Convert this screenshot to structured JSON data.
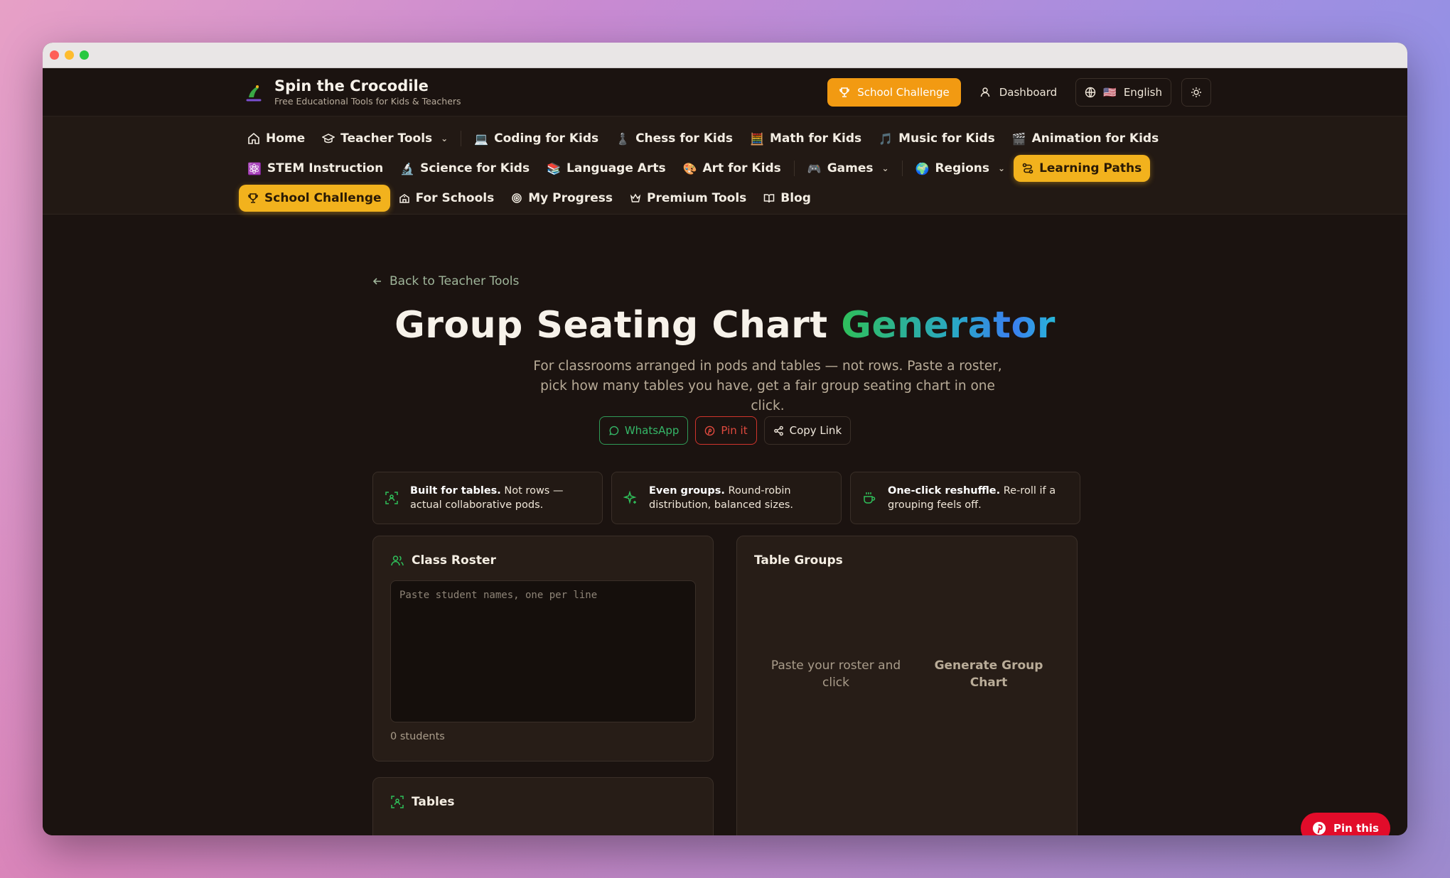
{
  "header": {
    "brand_title": "Spin the Crocodile",
    "brand_subtitle": "Free Educational Tools for Kids & Teachers",
    "challenge_button": "School Challenge",
    "dashboard_link": "Dashboard",
    "language": "English",
    "flag": "🇺🇸"
  },
  "nav": {
    "row1": [
      {
        "label": "Home"
      },
      {
        "label": "Teacher Tools"
      },
      {
        "label": "Coding for Kids",
        "emoji": "💻"
      },
      {
        "label": "Chess for Kids",
        "emoji": "♟️"
      },
      {
        "label": "Math for Kids",
        "emoji": "🧮"
      },
      {
        "label": "Music for Kids",
        "emoji": "🎵"
      },
      {
        "label": "Animation for Kids",
        "emoji": "🎬"
      }
    ],
    "row2": [
      {
        "label": "STEM Instruction",
        "emoji": "⚛️"
      },
      {
        "label": "Science for Kids",
        "emoji": "🔬"
      },
      {
        "label": "Language Arts",
        "emoji": "📚"
      },
      {
        "label": "Art for Kids",
        "emoji": "🎨"
      },
      {
        "label": "Games",
        "emoji": "🎮"
      },
      {
        "label": "Regions",
        "emoji": "🌍"
      },
      {
        "label": "Learning Paths"
      }
    ],
    "row3": [
      {
        "label": "School Challenge"
      },
      {
        "label": "For Schools"
      },
      {
        "label": "My Progress"
      },
      {
        "label": "Premium Tools"
      },
      {
        "label": "Blog"
      }
    ]
  },
  "page": {
    "back_link": "Back to Teacher Tools",
    "title_main": "Group Seating Chart ",
    "title_accent": "Generator",
    "subtitle": "For classrooms arranged in pods and tables — not rows. Paste a roster, pick how many tables you have, get a fair group seating chart in one click.",
    "share": {
      "whatsapp": "WhatsApp",
      "pin": "Pin it",
      "copy": "Copy Link"
    },
    "features": [
      {
        "bold": "Built for tables.",
        "text": " Not rows — actual collaborative pods."
      },
      {
        "bold": "Even groups.",
        "text": " Round-robin distribution, balanced sizes."
      },
      {
        "bold": "One-click reshuffle.",
        "text": " Re-roll if a grouping feels off."
      }
    ],
    "roster": {
      "title": "Class Roster",
      "placeholder": "Paste student names, one per line",
      "count": "0 students"
    },
    "tables": {
      "title": "Tables"
    },
    "groups": {
      "title": "Table Groups",
      "empty_text": "Paste your roster and click",
      "empty_action": "Generate Group Chart"
    },
    "pin_float": "Pin this"
  },
  "colors": {
    "accent_orange": "#f29a12",
    "accent_yellow": "#f2b21d",
    "green": "#2fbf5a",
    "pinterest_red": "#e20c2a"
  }
}
